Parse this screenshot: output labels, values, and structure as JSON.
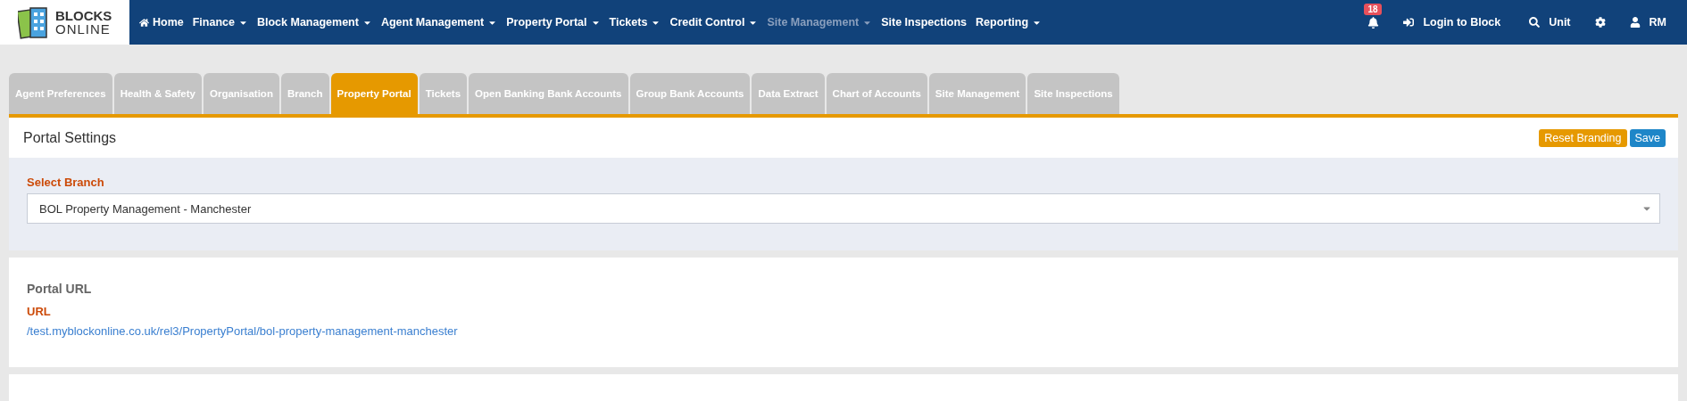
{
  "logo": {
    "line1": "BLOCKS",
    "line2": "ONLINE"
  },
  "nav": [
    {
      "label": "Home",
      "kind": "home",
      "dropdown": false,
      "disabled": false
    },
    {
      "label": "Finance",
      "kind": "plain",
      "dropdown": true,
      "disabled": false
    },
    {
      "label": "Block Management",
      "kind": "plain",
      "dropdown": true,
      "disabled": false
    },
    {
      "label": "Agent Management",
      "kind": "plain",
      "dropdown": true,
      "disabled": false
    },
    {
      "label": "Property Portal",
      "kind": "plain",
      "dropdown": true,
      "disabled": false
    },
    {
      "label": "Tickets",
      "kind": "plain",
      "dropdown": true,
      "disabled": false
    },
    {
      "label": "Credit Control",
      "kind": "plain",
      "dropdown": true,
      "disabled": false
    },
    {
      "label": "Site Management",
      "kind": "plain",
      "dropdown": true,
      "disabled": true
    },
    {
      "label": "Site Inspections",
      "kind": "plain",
      "dropdown": false,
      "disabled": false
    },
    {
      "label": "Reporting",
      "kind": "plain",
      "dropdown": true,
      "disabled": false
    }
  ],
  "nav_right": [
    {
      "kind": "bell",
      "badge": "18"
    },
    {
      "kind": "login",
      "label": "Login to Block"
    },
    {
      "kind": "search",
      "label": "Unit"
    },
    {
      "kind": "gear"
    },
    {
      "kind": "user",
      "label": "RM"
    }
  ],
  "tabs": [
    {
      "label": "Agent Preferences",
      "selected": false
    },
    {
      "label": "Health & Safety",
      "selected": false
    },
    {
      "label": "Organisation",
      "selected": false
    },
    {
      "label": "Branch",
      "selected": false
    },
    {
      "label": "Property Portal",
      "selected": true
    },
    {
      "label": "Tickets",
      "selected": false
    },
    {
      "label": "Open Banking Bank Accounts",
      "selected": false
    },
    {
      "label": "Group Bank Accounts",
      "selected": false
    },
    {
      "label": "Data Extract",
      "selected": false
    },
    {
      "label": "Chart of Accounts",
      "selected": false
    },
    {
      "label": "Site Management",
      "selected": false
    },
    {
      "label": "Site Inspections",
      "selected": false
    }
  ],
  "header": {
    "title": "Portal Settings",
    "buttons": [
      {
        "label": "Reset Branding",
        "kind": "warning"
      },
      {
        "label": "Save",
        "kind": "primary"
      }
    ]
  },
  "branch": {
    "label": "Select Branch",
    "value": "BOL Property Management - Manchester"
  },
  "portal_url": {
    "title": "Portal URL",
    "label": "URL",
    "link": "/test.myblockonline.co.uk/rel3/PropertyPortal/bol-property-management-manchester"
  }
}
